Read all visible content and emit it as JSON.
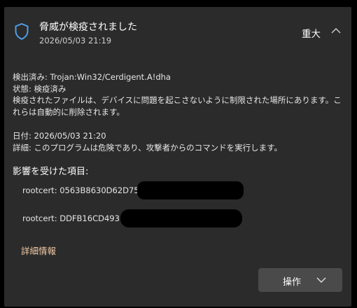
{
  "alert": {
    "title": "脅威が検疫されました",
    "timestamp": "2026/05/03 21:19",
    "severity": "重大",
    "icon": "shield-icon"
  },
  "details": {
    "detected": "検出済み: Trojan:Win32/Cerdigent.A!dha",
    "status": "状態: 検疫済み",
    "description": "検疫されたファイルは、デバイスに問題を起こさないように制限された場所にあります。これらは自動的に削除されます。",
    "date": "日付: 2026/05/03 21:20",
    "detail": "詳細: このプログラムは危険であり、攻撃者からのコマンドを実行します。"
  },
  "affected": {
    "title": "影響を受けた項目:",
    "items": [
      "rootcert: 0563B8630D62D75A                                       A899B24D43",
      "rootcert: DDFB16CD493                                                    0775D05E4"
    ]
  },
  "links": {
    "more_info": "詳細情報"
  },
  "actions": {
    "label": "操作"
  },
  "colors": {
    "background": "#2b2b2b",
    "accent": "#4f9fea",
    "link": "#f0c9a3",
    "button": "#4a4a4a"
  }
}
